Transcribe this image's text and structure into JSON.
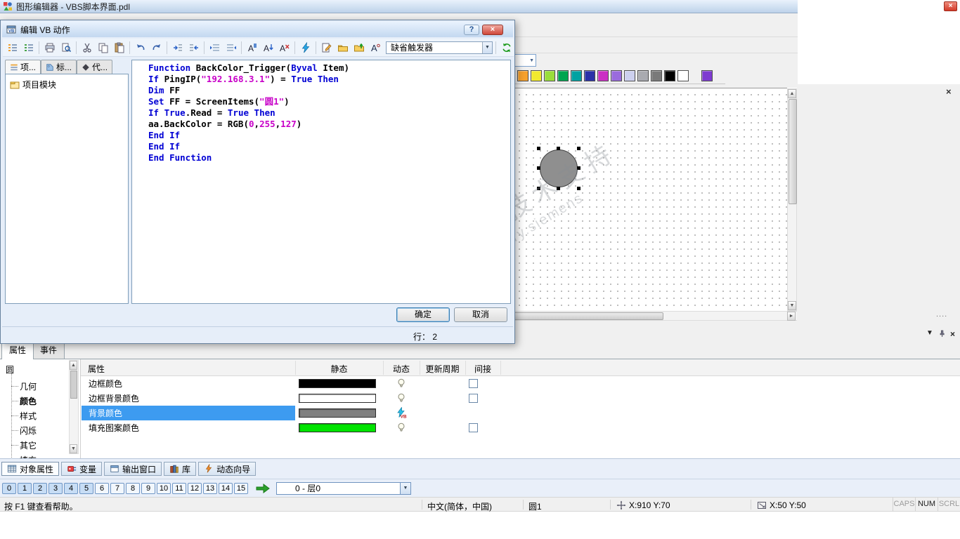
{
  "window": {
    "title": "图形编辑器 - VBS脚本界面.pdl"
  },
  "watermark": {
    "line1": "西门子工业 技术支持",
    "line2": "support.industry.siemens"
  },
  "palette": {
    "colors": [
      "#f7a12d",
      "#f2ea2f",
      "#9ade3a",
      "#00a550",
      "#00a2a2",
      "#2b31a8",
      "#cb2fc4",
      "#9a6bdd",
      "#cdd0ef",
      "#a9aab0",
      "#7a7a7a",
      "#000000",
      "#ffffff"
    ],
    "extra": "#7e3bd0"
  },
  "dialog": {
    "title": "编辑 VB 动作",
    "help_label": "?",
    "close_label": "×",
    "toolbar": {
      "trigger_value": "缺省触发器",
      "items": [
        {
          "icon": "script-list-icon"
        },
        {
          "icon": "action-list-icon"
        },
        {
          "sep": true
        },
        {
          "icon": "print-icon"
        },
        {
          "icon": "print-preview-icon"
        },
        {
          "sep": true
        },
        {
          "icon": "cut-icon"
        },
        {
          "icon": "copy-icon"
        },
        {
          "icon": "paste-icon"
        },
        {
          "sep": true
        },
        {
          "icon": "undo-icon"
        },
        {
          "icon": "redo-icon"
        },
        {
          "sep": true
        },
        {
          "icon": "indent-icon"
        },
        {
          "icon": "outdent-icon"
        },
        {
          "sep": true
        },
        {
          "icon": "comment-icon"
        },
        {
          "icon": "uncomment-icon"
        },
        {
          "sep": true
        },
        {
          "icon": "bookmark-icon"
        },
        {
          "icon": "bookmark-next-icon"
        },
        {
          "icon": "bookmark-clear-icon"
        },
        {
          "sep": true
        },
        {
          "icon": "syntax-check-icon"
        },
        {
          "sep": true
        },
        {
          "icon": "edit-action-icon"
        },
        {
          "icon": "import-icon"
        },
        {
          "icon": "export-icon"
        },
        {
          "icon": "font-icon"
        },
        {
          "combo": true
        },
        {
          "sep": true
        },
        {
          "icon": "refresh-icon"
        }
      ]
    },
    "tabs": [
      {
        "label": "项...",
        "icon": "project-tab-icon"
      },
      {
        "label": "标...",
        "icon": "tags-tab-icon"
      },
      {
        "label": "代...",
        "icon": "code-tab-icon"
      }
    ],
    "tree_root": "项目模块",
    "code_lines": [
      [
        {
          "c": "k",
          "t": "Function "
        },
        {
          "c": "p",
          "t": "BackColor_Trigger("
        },
        {
          "c": "k",
          "t": "Byval"
        },
        {
          "c": "p",
          "t": " Item)"
        }
      ],
      [
        {
          "c": "k",
          "t": "If "
        },
        {
          "c": "p",
          "t": "PingIP("
        },
        {
          "c": "s",
          "t": "\"192.168.3.1\""
        },
        {
          "c": "p",
          "t": ") = "
        },
        {
          "c": "k",
          "t": "True "
        },
        {
          "c": "k",
          "t": "Then"
        }
      ],
      [
        {
          "c": "k",
          "t": "Dim "
        },
        {
          "c": "p",
          "t": "FF"
        }
      ],
      [
        {
          "c": "k",
          "t": "Set "
        },
        {
          "c": "p",
          "t": "FF = ScreenItems("
        },
        {
          "c": "s",
          "t": "\"圆1\""
        },
        {
          "c": "p",
          "t": ")"
        }
      ],
      [
        {
          "c": "k",
          "t": "If "
        },
        {
          "c": "k",
          "t": "True"
        },
        {
          "c": "p",
          "t": ".Read = "
        },
        {
          "c": "k",
          "t": "True "
        },
        {
          "c": "k",
          "t": "Then"
        }
      ],
      [
        {
          "c": "p",
          "t": "aa.BackColor = RGB("
        },
        {
          "c": "n",
          "t": "0"
        },
        {
          "c": "p",
          "t": ","
        },
        {
          "c": "n",
          "t": "255"
        },
        {
          "c": "p",
          "t": ","
        },
        {
          "c": "n",
          "t": "127"
        },
        {
          "c": "p",
          "t": ")"
        }
      ],
      [
        {
          "c": "k",
          "t": "End If"
        }
      ],
      [
        {
          "c": "k",
          "t": "End If"
        }
      ],
      [
        {
          "c": "k",
          "t": "End Function"
        }
      ]
    ],
    "ok_label": "确定",
    "cancel_label": "取消",
    "status_line": "行： 2"
  },
  "properties_panel": {
    "tabs": [
      "属性",
      "事件"
    ],
    "object_name": "圆",
    "tree_items": [
      {
        "label": "几何"
      },
      {
        "label": "颜色",
        "bold": true
      },
      {
        "label": "样式"
      },
      {
        "label": "闪烁"
      },
      {
        "label": "其它"
      },
      {
        "label": "填充"
      }
    ],
    "columns": [
      "属性",
      "静态",
      "动态",
      "更新周期",
      "间接"
    ],
    "rows": [
      {
        "name": "边框颜色",
        "color": "#000000",
        "dyn": "bulb",
        "indirect": true
      },
      {
        "name": "边框背景颜色",
        "color": "#ffffff",
        "dyn": "bulb",
        "indirect": true
      },
      {
        "name": "背景颜色",
        "color": "#808080",
        "dyn": "vb",
        "indirect": false,
        "selected": true
      },
      {
        "name": "填充图案颜色",
        "color": "#00e400",
        "dyn": "bulb",
        "indirect": true
      }
    ]
  },
  "bottom_tabs": [
    {
      "id": "object-properties",
      "label": "对象属性",
      "icon": "grid-icon",
      "active": true
    },
    {
      "id": "tags",
      "label": "变量",
      "icon": "tag-icon"
    },
    {
      "id": "output-window",
      "label": "输出窗口",
      "icon": "window-icon"
    },
    {
      "id": "library",
      "label": "库",
      "icon": "library-icon"
    },
    {
      "id": "dynamic-wizard",
      "label": "动态向导",
      "icon": "wizard-icon"
    }
  ],
  "layers": {
    "buttons": [
      "0",
      "1",
      "2",
      "3",
      "4",
      "5",
      "6",
      "7",
      "8",
      "9",
      "10",
      "11",
      "12",
      "13",
      "14",
      "15"
    ],
    "active_count": 6,
    "dropdown_value": "0 - 层0"
  },
  "statusbar": {
    "help": "按 F1 键查看帮助。",
    "locale": "中文(简体，中国)",
    "object": "圆1",
    "position": "X:910 Y:70",
    "size": "X:50 Y:50",
    "keys": [
      {
        "label": "CAPS",
        "on": false
      },
      {
        "label": "NUM",
        "on": true
      },
      {
        "label": "SCRL",
        "on": false
      }
    ]
  }
}
